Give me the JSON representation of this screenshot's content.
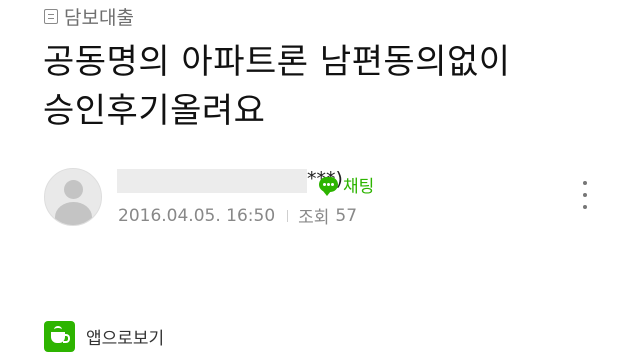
{
  "board": {
    "label": "담보대출",
    "icon": "board-list-icon"
  },
  "post": {
    "title_line1": "공동명의 아파트론 남편동의없이",
    "title_line2": "승인후기올려요"
  },
  "author": {
    "nickname_tail": "***)",
    "chat_label": "채팅",
    "date": "2016.04.05. 16:50",
    "views_label": "조회",
    "views_count": "57"
  },
  "app_link": {
    "label": "앱으로보기",
    "icon": "cafe-app-icon"
  },
  "colors": {
    "accent": "#2db400",
    "muted_text": "#888888",
    "board_text": "#6f6f6f"
  }
}
